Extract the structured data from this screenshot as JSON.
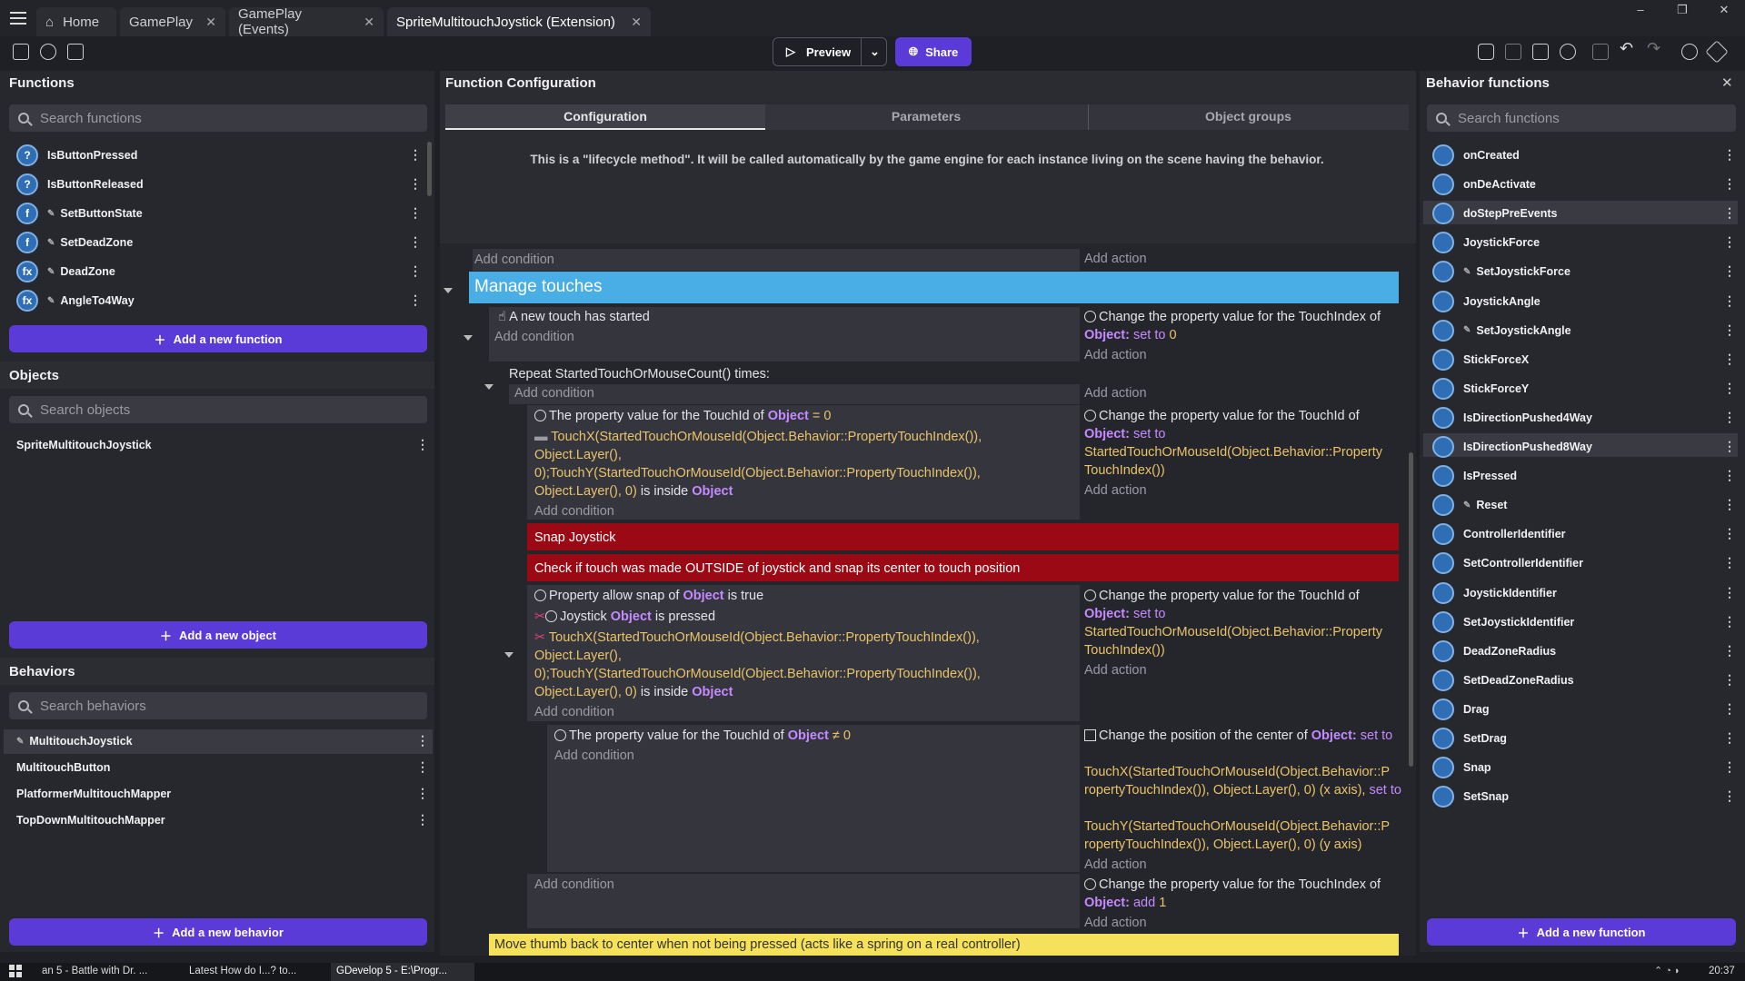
{
  "tabs": [
    {
      "label": "Home"
    },
    {
      "label": "GamePlay"
    },
    {
      "label": "GamePlay (Events)"
    },
    {
      "label": "SpriteMultitouchJoystick (Extension)"
    }
  ],
  "toolbar": {
    "preview_label": "Preview",
    "share_label": "Share"
  },
  "left": {
    "functions_title": "Functions",
    "search_functions": "Search functions",
    "functions": [
      {
        "label": "IsButtonPressed",
        "icon": "?"
      },
      {
        "label": "IsButtonReleased",
        "icon": "?"
      },
      {
        "label": "SetButtonState",
        "icon": "f"
      },
      {
        "label": "SetDeadZone",
        "icon": "f"
      },
      {
        "label": "DeadZone",
        "icon": "fx"
      },
      {
        "label": "AngleTo4Way",
        "icon": "fx"
      }
    ],
    "add_function": "Add a new function",
    "objects_title": "Objects",
    "search_objects": "Search objects",
    "objects": [
      {
        "label": "SpriteMultitouchJoystick"
      }
    ],
    "add_object": "Add a new object",
    "behaviors_title": "Behaviors",
    "search_behaviors": "Search behaviors",
    "behaviors": [
      {
        "label": "MultitouchJoystick"
      },
      {
        "label": "MultitouchButton"
      },
      {
        "label": "PlatformerMultitouchMapper"
      },
      {
        "label": "TopDownMultitouchMapper"
      }
    ],
    "add_behavior": "Add a new behavior"
  },
  "center": {
    "title": "Function Configuration",
    "tabs": [
      "Configuration",
      "Parameters",
      "Object groups"
    ],
    "description": "This is a \"lifecycle method\". It will be called automatically by the game engine for each instance living on the scene having the behavior.",
    "add_condition": "Add condition",
    "add_action": "Add action",
    "group_title": "Manage touches",
    "new_touch": "A new touch has started",
    "act_touchindex_0": "Change the property value for the TouchIndex of",
    "act_obj": "Object:",
    "set_to": "set to",
    "zero": "0",
    "repeat": "Repeat StartedTouchOrMouseCount() times:",
    "cond_touchid_eq": "The property value for the TouchId of",
    "eq0": "= 0",
    "inside_line1": "TouchX(StartedTouchOrMouseId(Object.Behavior::PropertyTouchIndex()),",
    "inside_line2": "Object.Layer(),",
    "inside_line3": "0);TouchY(StartedTouchOrMouseId(Object.Behavior::PropertyTouchIndex()),",
    "inside_line4": "Object.Layer(), 0)",
    "is_inside": "is inside",
    "act_touchid": "Change the property value for the TouchId of",
    "act_touchid_val1": "StartedTouchOrMouseId(Object.Behavior::Property",
    "act_touchid_val2": "TouchIndex())",
    "comment1": "Snap Joystick",
    "comment2": "Check if touch was made OUTSIDE of joystick and snap its center to touch position",
    "allow_snap": "Property allow snap of",
    "is_true": "is true",
    "joystick": "Joystick",
    "is_pressed": "is pressed",
    "neq0": "≠ 0",
    "act_pos": "Change the position of the center of",
    "pos_l1": "TouchX(StartedTouchOrMouseId(Object.Behavior::P",
    "pos_l2": "ropertyTouchIndex()), Object.Layer(), 0)",
    "pos_xaxis": "(x axis),",
    "pos_l3": "TouchY(StartedTouchOrMouseId(Object.Behavior::P",
    "pos_l4": "ropertyTouchIndex()), Object.Layer(), 0)",
    "pos_yaxis": "(y axis)",
    "add_word": "add",
    "one": "1",
    "objword": "Object",
    "bottom_comment": "Move thumb back to center when not being pressed (acts like a spring on a real controller)"
  },
  "right": {
    "title": "Behavior functions",
    "search": "Search functions",
    "items": [
      {
        "label": "onCreated"
      },
      {
        "label": "onDeActivate"
      },
      {
        "label": "doStepPreEvents"
      },
      {
        "label": "JoystickForce"
      },
      {
        "label": "SetJoystickForce"
      },
      {
        "label": "JoystickAngle"
      },
      {
        "label": "SetJoystickAngle"
      },
      {
        "label": "StickForceX"
      },
      {
        "label": "StickForceY"
      },
      {
        "label": "IsDirectionPushed4Way"
      },
      {
        "label": "IsDirectionPushed8Way"
      },
      {
        "label": "IsPressed"
      },
      {
        "label": "Reset"
      },
      {
        "label": "ControllerIdentifier"
      },
      {
        "label": "SetControllerIdentifier"
      },
      {
        "label": "JoystickIdentifier"
      },
      {
        "label": "SetJoystickIdentifier"
      },
      {
        "label": "DeadZoneRadius"
      },
      {
        "label": "SetDeadZoneRadius"
      },
      {
        "label": "Drag"
      },
      {
        "label": "SetDrag"
      },
      {
        "label": "Snap"
      },
      {
        "label": "SetSnap"
      }
    ],
    "add_function": "Add a new function"
  },
  "taskbar": {
    "items": [
      "an 5 - Battle with Dr. ...",
      "Latest How do I...? to...",
      "GDevelop 5 - E:\\Progr..."
    ],
    "clock": "20:37"
  }
}
